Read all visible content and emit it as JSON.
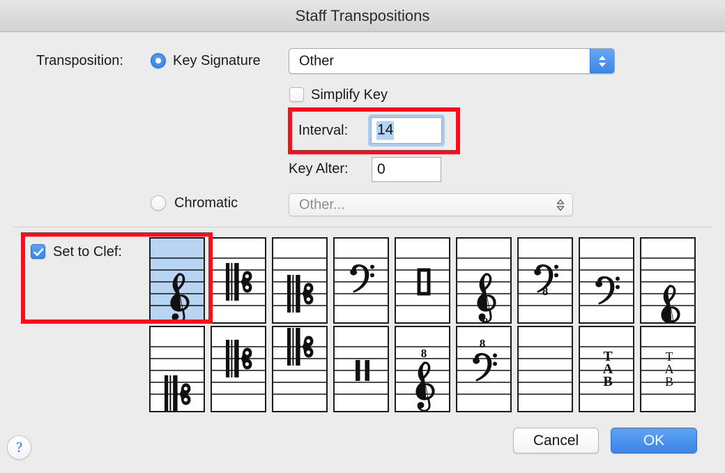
{
  "window": {
    "title": "Staff Transpositions"
  },
  "transposition": {
    "label": "Transposition:",
    "key_signature": {
      "radio_label": "Key Signature",
      "selected": true,
      "popup_value": "Other"
    },
    "simplify_key": {
      "label": "Simplify Key",
      "checked": false
    },
    "interval": {
      "label": "Interval:",
      "value": "14",
      "focused": true,
      "text_selected": true
    },
    "key_alter": {
      "label": "Key Alter:",
      "value": "0"
    },
    "chromatic": {
      "radio_label": "Chromatic",
      "selected": false,
      "popup_value": "Other...",
      "disabled": true
    }
  },
  "set_to_clef": {
    "label": "Set to Clef:",
    "checked": true,
    "selected_index": 0,
    "clefs": [
      {
        "name": "treble-clef",
        "glyph": "treble",
        "line": 2,
        "octave": ""
      },
      {
        "name": "alto-clef",
        "glyph": "c-clef",
        "line": 3,
        "octave": ""
      },
      {
        "name": "mezzo-soprano-clef",
        "glyph": "c-clef",
        "line": 2,
        "octave": ""
      },
      {
        "name": "bass-clef",
        "glyph": "bass",
        "line": 4,
        "octave": ""
      },
      {
        "name": "percussion-clef-box",
        "glyph": "perc-box",
        "line": 3,
        "octave": ""
      },
      {
        "name": "treble-clef-8vb",
        "glyph": "treble",
        "line": 2,
        "octave": "8below"
      },
      {
        "name": "bass-clef-8vb",
        "glyph": "bass",
        "line": 4,
        "octave": "8below"
      },
      {
        "name": "baritone-f-clef",
        "glyph": "bass",
        "line": 3,
        "octave": ""
      },
      {
        "name": "french-violin-clef",
        "glyph": "treble",
        "line": 1,
        "octave": ""
      },
      {
        "name": "soprano-clef",
        "glyph": "c-clef",
        "line": 1,
        "octave": ""
      },
      {
        "name": "tenor-clef",
        "glyph": "c-clef",
        "line": 4,
        "octave": ""
      },
      {
        "name": "baritone-c-clef",
        "glyph": "c-clef",
        "line": 5,
        "octave": ""
      },
      {
        "name": "percussion-clef-bars",
        "glyph": "perc-bars",
        "line": 3,
        "octave": ""
      },
      {
        "name": "treble-clef-8va",
        "glyph": "treble",
        "line": 2,
        "octave": "8above"
      },
      {
        "name": "bass-clef-8va",
        "glyph": "bass",
        "line": 4,
        "octave": "8above"
      },
      {
        "name": "blank-clef",
        "glyph": "blank",
        "line": 3,
        "octave": ""
      },
      {
        "name": "tab-clef-bold",
        "glyph": "tab-bold",
        "line": 3,
        "octave": ""
      },
      {
        "name": "tab-clef-serif",
        "glyph": "tab-serif",
        "line": 3,
        "octave": ""
      }
    ]
  },
  "footer": {
    "help_label": "?",
    "cancel_label": "Cancel",
    "ok_label": "OK"
  },
  "annotations": {
    "interval_highlight": "red-box-interval",
    "set_to_clef_highlight": "red-box-set-to-clef"
  },
  "colors": {
    "accent_blue": "#3b86e8",
    "selection_blue": "#b7d4f3",
    "annotation_red": "#fc0d1b",
    "window_bg": "#ececec",
    "titlebar_bg": "#dcdcdc"
  }
}
